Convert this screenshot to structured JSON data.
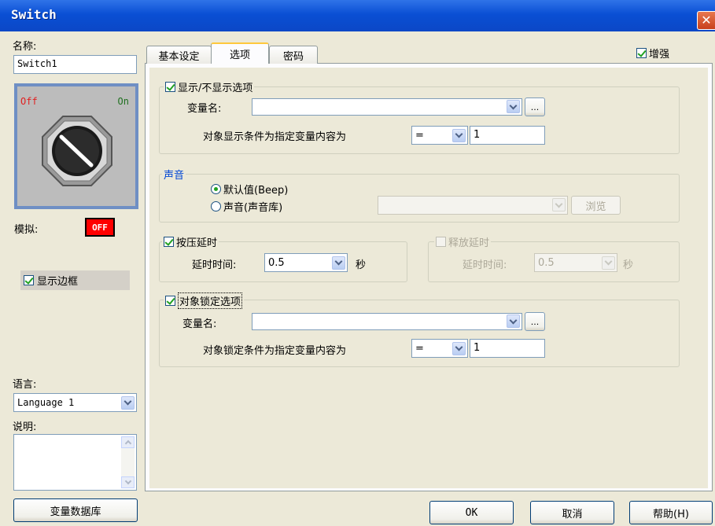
{
  "window": {
    "title": "Switch"
  },
  "left": {
    "name_label": "名称:",
    "name_value": "Switch1",
    "preview": {
      "off_label": "Off",
      "on_label": "On"
    },
    "simulate_label": "模拟:",
    "simulate_value": "OFF",
    "show_border_label": "显示边框",
    "show_border_checked": true,
    "language_label": "语言:",
    "language_value": "Language 1",
    "description_label": "说明:",
    "description_value": "",
    "var_db_button": "变量数据库"
  },
  "tabs": [
    {
      "label": "基本设定",
      "active": false
    },
    {
      "label": "选项",
      "active": true
    },
    {
      "label": "密码",
      "active": false
    }
  ],
  "enhance": {
    "label": "增强",
    "checked": true
  },
  "display_group": {
    "title": "显示/不显示选项",
    "checked": true,
    "var_label": "变量名:",
    "var_value": "",
    "browse_label": "...",
    "condition_label": "对象显示条件为指定变量内容为",
    "operator": "=",
    "value": "1"
  },
  "sound_group": {
    "title": "声音",
    "option_default": "默认值(Beep)",
    "option_sound": "声音(声音库)",
    "selected": "default",
    "browse_label": "浏览"
  },
  "press_delay": {
    "title": "按压延时",
    "checked": true,
    "time_label": "延时时间:",
    "value": "0.5",
    "unit": "秒"
  },
  "release_delay": {
    "title": "释放延时",
    "checked": false,
    "time_label": "延时时间:",
    "value": "0.5",
    "unit": "秒"
  },
  "lock_group": {
    "title": "对象锁定选项",
    "checked": true,
    "var_label": "变量名:",
    "var_value": "",
    "browse_label": "...",
    "condition_label": "对象锁定条件为指定变量内容为",
    "operator": "=",
    "value": "1"
  },
  "buttons": {
    "ok": "OK",
    "cancel": "取消",
    "help": "帮助(H)"
  },
  "colors": {
    "titlebar": "#0a4fd4",
    "simulate_bg": "#ff0000",
    "accent_checkmark": "#21a121"
  }
}
